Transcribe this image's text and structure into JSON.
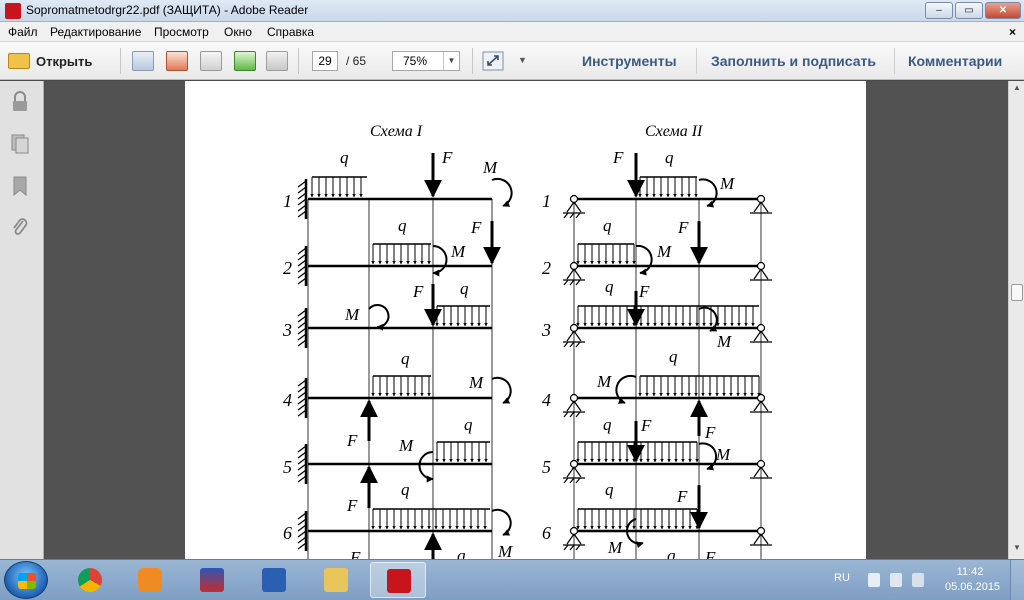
{
  "window": {
    "title": "Sopromatmetodrgr22.pdf (ЗАЩИТА) - Adobe Reader",
    "controls": {
      "minimize": "–",
      "maximize": "▭",
      "close": "✕"
    }
  },
  "menu": {
    "items": [
      "Файл",
      "Редактирование",
      "Просмотр",
      "Окно",
      "Справка"
    ],
    "close_label": "×"
  },
  "toolbar": {
    "open_label": "Открыть",
    "page_current": "29",
    "page_total": "/ 65",
    "zoom": "75%",
    "tools_label": "Инструменты",
    "fill_sign_label": "Заполнить и подписать",
    "comments_label": "Комментарии"
  },
  "document": {
    "scheme1_title": "Схема I",
    "scheme2_title": "Схема II",
    "row_numbers": [
      "1",
      "2",
      "3",
      "4",
      "5",
      "6"
    ],
    "labels": {
      "q": "q",
      "F": "F",
      "M": "M"
    }
  },
  "taskbar": {
    "apps": [
      "start",
      "chrome",
      "media-player",
      "xp-app",
      "word",
      "file-explorer",
      "adobe-reader"
    ],
    "active_app": "adobe-reader",
    "language": "RU",
    "time": "11:42",
    "date": "05.06.2015"
  },
  "colors": {
    "accent_link": "#3a5a86",
    "doc_background": "#525252",
    "taskbar": "#8aa9cd"
  }
}
